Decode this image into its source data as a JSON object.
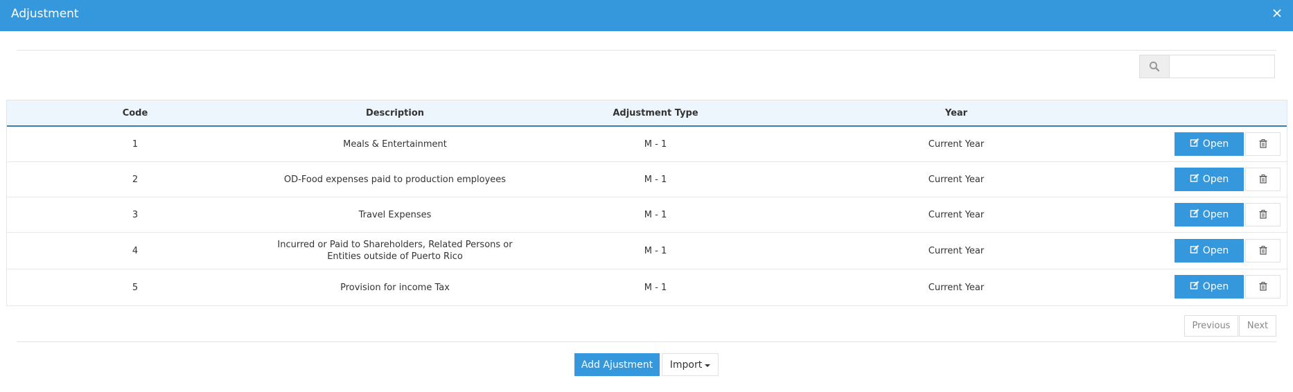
{
  "header": {
    "title": "Adjustment",
    "close_icon": "close-icon"
  },
  "search": {
    "icon": "search-icon",
    "value": "",
    "placeholder": ""
  },
  "table": {
    "columns": [
      "Code",
      "Description",
      "Adjustment Type",
      "Year"
    ],
    "rows": [
      {
        "code": "1",
        "description": "Meals & Entertainment",
        "type": "M - 1",
        "year": "Current Year",
        "open_label": "Open"
      },
      {
        "code": "2",
        "description": "OD-Food expenses paid to production employees",
        "type": "M - 1",
        "year": "Current Year",
        "open_label": "Open"
      },
      {
        "code": "3",
        "description": "Travel Expenses",
        "type": "M - 1",
        "year": "Current Year",
        "open_label": "Open"
      },
      {
        "code": "4",
        "description": "Incurred or Paid to Shareholders, Related Persons or Entities outside of Puerto Rico",
        "type": "M - 1",
        "year": "Current Year",
        "open_label": "Open"
      },
      {
        "code": "5",
        "description": "Provision for income Tax",
        "type": "M - 1",
        "year": "Current Year",
        "open_label": "Open"
      }
    ]
  },
  "pagination": {
    "previous": "Previous",
    "next": "Next"
  },
  "footer": {
    "add_label": "Add Ajustment",
    "import_label": "Import"
  },
  "colors": {
    "primary": "#3598dc",
    "header_row_bg": "#eef6fd",
    "header_row_border": "#3a7ea6"
  }
}
